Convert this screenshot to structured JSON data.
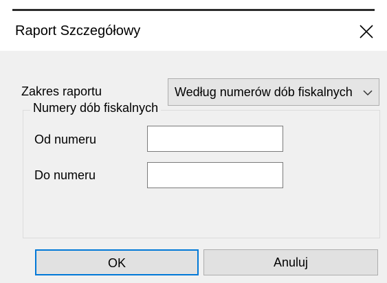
{
  "window": {
    "title": "Raport Szczegółowy"
  },
  "report_range": {
    "label": "Zakres raportu",
    "selected_value": "Według numerów dób fiskalnych"
  },
  "group": {
    "legend": "Numery dób fiskalnych",
    "from_label": "Od numeru",
    "from_value": "",
    "to_label": "Do numeru",
    "to_value": ""
  },
  "buttons": {
    "ok_label": "OK",
    "cancel_label": "Anuluj"
  },
  "icons": {
    "close": "close-icon",
    "dropdown": "chevron-down-icon"
  },
  "colors": {
    "focus_border": "#0078d7",
    "dialog_background": "#f0f0f0"
  }
}
